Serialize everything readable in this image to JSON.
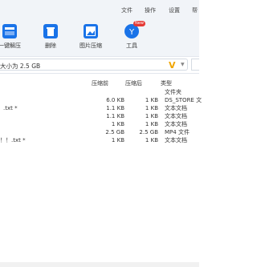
{
  "menu": [
    "文件",
    "操作",
    "设置",
    "帮"
  ],
  "toolbar": {
    "items": [
      {
        "label": "一键解压",
        "icon": "unzip-icon"
      },
      {
        "label": "删除",
        "icon": "trash-icon"
      },
      {
        "label": "图片压缩",
        "icon": "image-compress-icon"
      },
      {
        "label": "工具",
        "icon": "toolbox-icon",
        "badge": "New"
      }
    ]
  },
  "pathbar": {
    "text": "大小为 2.5 GB"
  },
  "table": {
    "headers": {
      "compressed": "压缩前",
      "after": "压缩后",
      "type": "类型"
    },
    "rows": [
      {
        "name": "",
        "before": "",
        "after": "",
        "type": "文件夹"
      },
      {
        "name": "",
        "before": "6.0 KB",
        "after": "1 KB",
        "type": "DS_STORE 文"
      },
      {
        "name": ".txt *",
        "before": "1.1 KB",
        "after": "1 KB",
        "type": "文本文档"
      },
      {
        "name": "",
        "before": "1.1 KB",
        "after": "1 KB",
        "type": "文本文档"
      },
      {
        "name": "",
        "before": "1 KB",
        "after": "1 KB",
        "type": "文本文档"
      },
      {
        "name": "",
        "before": "2.5 GB",
        "after": "2.5 GB",
        "type": "MP4 文件"
      },
      {
        "name": "！！.txt *",
        "before": "1 KB",
        "after": "1 KB",
        "type": "文本文档"
      }
    ]
  },
  "colors": {
    "accent": "#1a73e8",
    "toolbar_bg": "#f1f4f8",
    "folder_yellow": "#f0a500"
  }
}
